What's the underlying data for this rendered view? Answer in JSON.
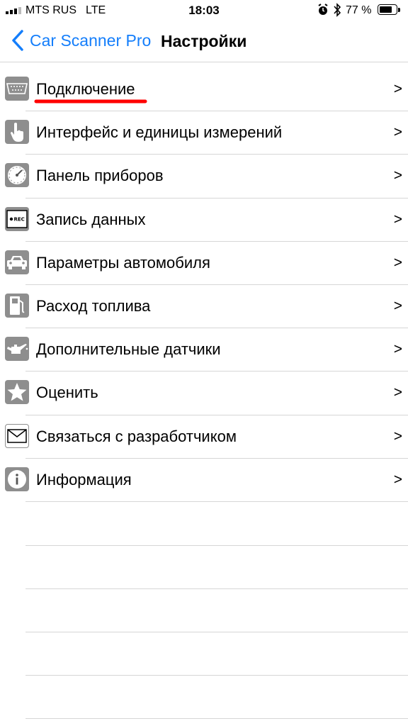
{
  "status_bar": {
    "carrier": "MTS RUS",
    "network": "LTE",
    "time": "18:03",
    "battery_percent": "77 %",
    "battery_level": 0.77
  },
  "nav": {
    "back_label": "Car Scanner Pro",
    "title": "Настройки",
    "accent_color": "#147efb"
  },
  "settings": {
    "items": [
      {
        "label": "Подключение",
        "icon": "obd-connector-icon",
        "chevron": ">"
      },
      {
        "label": "Интерфейс и единицы измерений",
        "icon": "hand-pointer-icon",
        "chevron": ">"
      },
      {
        "label": "Панель приборов",
        "icon": "gauge-icon",
        "chevron": ">"
      },
      {
        "label": "Запись данных",
        "icon": "rec-icon",
        "chevron": ">"
      },
      {
        "label": "Параметры автомобиля",
        "icon": "car-icon",
        "chevron": ">"
      },
      {
        "label": "Расход топлива",
        "icon": "fuel-pump-icon",
        "chevron": ">"
      },
      {
        "label": "Дополнительные датчики",
        "icon": "oil-can-icon",
        "chevron": ">"
      },
      {
        "label": "Оценить",
        "icon": "star-icon",
        "chevron": ">"
      },
      {
        "label": "Связаться с разработчиком",
        "icon": "envelope-icon",
        "chevron": ">"
      },
      {
        "label": "Информация",
        "icon": "info-icon",
        "chevron": ">"
      }
    ],
    "rec_text": "REC"
  },
  "annotation": {
    "underline_color": "#ff0000"
  }
}
